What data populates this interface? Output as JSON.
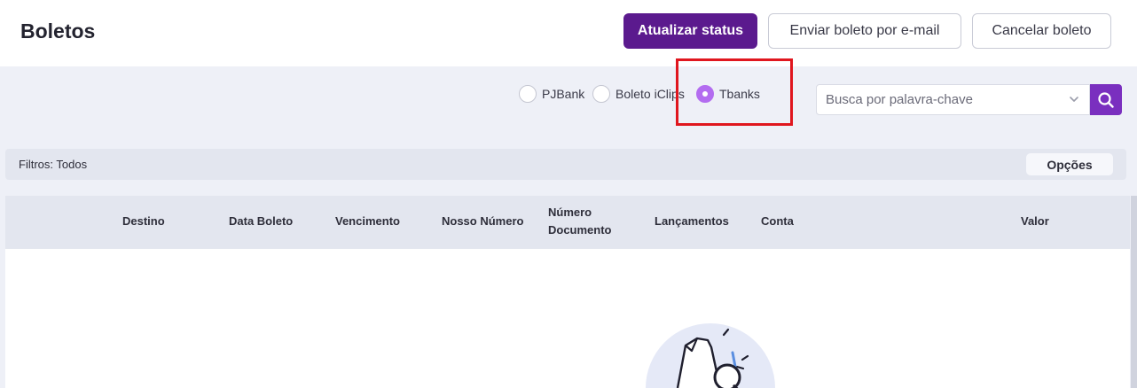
{
  "header": {
    "title": "Boletos",
    "update_status_label": "Atualizar status",
    "send_email_label": "Enviar boleto por e-mail",
    "cancel_label": "Cancelar boleto"
  },
  "providers": {
    "options": [
      {
        "label": "PJBank",
        "selected": false
      },
      {
        "label": "Boleto iClips",
        "selected": false
      },
      {
        "label": "Tbanks",
        "selected": true
      }
    ]
  },
  "search": {
    "placeholder": "Busca por palavra-chave",
    "value": ""
  },
  "filters": {
    "label": "Filtros: Todos",
    "options_label": "Opções"
  },
  "table": {
    "columns": [
      "Destino",
      "Data Boleto",
      "Vencimento",
      "Nosso Número",
      "Número Documento",
      "Lançamentos",
      "Conta",
      "Valor"
    ],
    "rows": []
  },
  "colors": {
    "primary": "#5b1a8e",
    "radio_selected": "#b36cf0",
    "search_button": "#7a2fbf",
    "highlight": "#e0161e"
  }
}
